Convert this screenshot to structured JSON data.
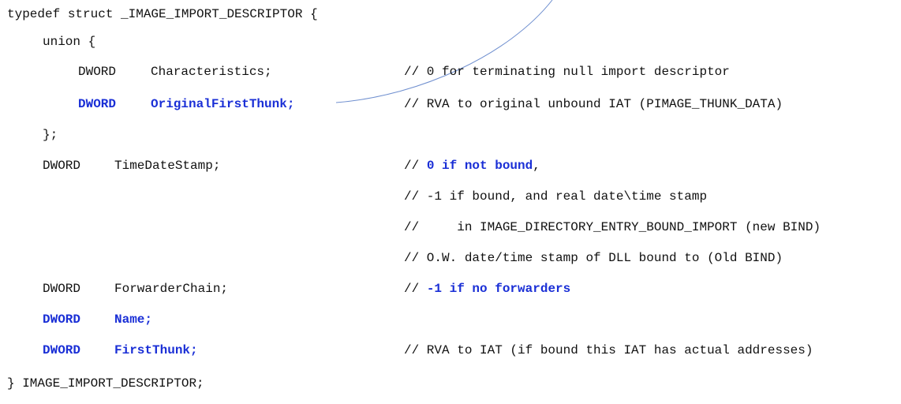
{
  "struct_header": "typedef struct _IMAGE_IMPORT_DESCRIPTOR {",
  "union_open": "union {",
  "union_close": "};",
  "struct_footer": "} IMAGE_IMPORT_DESCRIPTOR;",
  "fields": {
    "characteristics": {
      "type": "DWORD",
      "name": "Characteristics;",
      "comment": "// 0 for terminating null import descriptor"
    },
    "original_first_thunk": {
      "type": "DWORD",
      "name": "OriginalFirstThunk;",
      "comment": "// RVA to original unbound IAT (PIMAGE_THUNK_DATA)"
    },
    "time_date_stamp": {
      "type": "DWORD",
      "name": "TimeDateStamp;",
      "comment_prefix": "// ",
      "comment_bold": "0 if not bound",
      "comment_suffix": ",",
      "comment_lines": [
        "// -1 if bound, and real date\\time stamp",
        "//     in IMAGE_DIRECTORY_ENTRY_BOUND_IMPORT (new BIND)",
        "// O.W. date/time stamp of DLL bound to (Old BIND)"
      ]
    },
    "forwarder_chain": {
      "type": "DWORD",
      "name": "ForwarderChain;",
      "comment_prefix": "// ",
      "comment_bold": "-1 if no forwarders"
    },
    "name": {
      "type": "DWORD",
      "name": "Name;"
    },
    "first_thunk": {
      "type": "DWORD",
      "name": "FirstThunk;",
      "comment": "// RVA to IAT (if bound this IAT has actual addresses)"
    }
  },
  "colors": {
    "highlight": "#1a2fd6",
    "text": "#111111",
    "connector": "#6f8fcf"
  }
}
